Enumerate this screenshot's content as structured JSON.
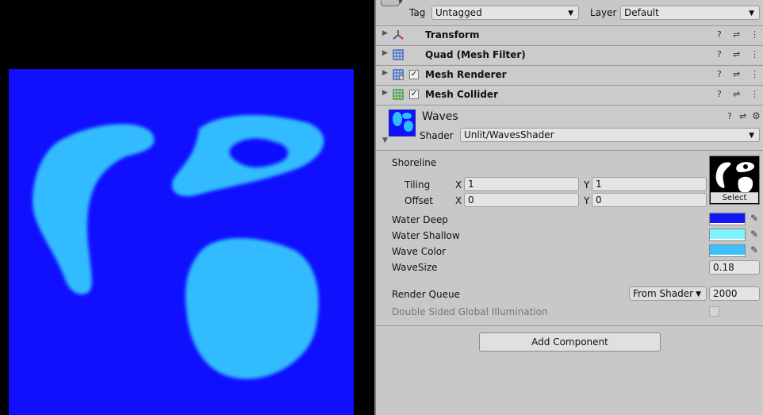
{
  "header": {
    "tag_label": "Tag",
    "tag_value": "Untagged",
    "layer_label": "Layer",
    "layer_value": "Default"
  },
  "components": [
    {
      "title": "Transform",
      "has_checkbox": false
    },
    {
      "title": "Quad (Mesh Filter)",
      "has_checkbox": false
    },
    {
      "title": "Mesh Renderer",
      "has_checkbox": true,
      "checked": "✓"
    },
    {
      "title": "Mesh Collider",
      "has_checkbox": true,
      "checked": "✓"
    }
  ],
  "material": {
    "name": "Waves",
    "shader_label": "Shader",
    "shader_value": "Unlit/WavesShader"
  },
  "properties": {
    "shoreline_label": "Shoreline",
    "tiling_label": "Tiling",
    "offset_label": "Offset",
    "x_label": "X",
    "y_label": "Y",
    "tiling_x": "1",
    "tiling_y": "1",
    "offset_x": "0",
    "offset_y": "0",
    "select_label": "Select",
    "water_deep_label": "Water Deep",
    "water_shallow_label": "Water Shallow",
    "wave_color_label": "Wave Color",
    "wavesize_label": "WaveSize",
    "wavesize_value": "0.18",
    "render_queue_label": "Render Queue",
    "render_queue_mode": "From Shader",
    "render_queue_value": "2000",
    "dsgi_label": "Double Sided Global Illumination"
  },
  "colors": {
    "water_deep": "#1418f5",
    "water_shallow": "#7ff3ff",
    "wave_color": "#3cc0ff",
    "scene_background": "#1010ff",
    "scene_islands": "#33bbff"
  },
  "buttons": {
    "add_component": "Add Component"
  },
  "icons": {
    "help": "?",
    "settings": "⇌",
    "menu": "⋮",
    "gear": "⚙",
    "eyedropper": "✎"
  }
}
